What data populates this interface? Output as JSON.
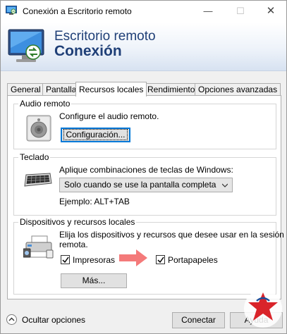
{
  "window": {
    "title": "Conexión a Escritorio remoto",
    "controls": {
      "minimize": "—",
      "maximize": "☐",
      "close": "✕"
    }
  },
  "banner": {
    "line1": "Escritorio remoto",
    "line2": "Conexión"
  },
  "tabs": [
    {
      "label": "General",
      "active": false
    },
    {
      "label": "Pantalla",
      "active": false
    },
    {
      "label": "Recursos locales",
      "active": true
    },
    {
      "label": "Rendimiento",
      "active": false
    },
    {
      "label": "Opciones avanzadas",
      "active": false
    }
  ],
  "audio": {
    "legend": "Audio remoto",
    "description": "Configure el audio remoto.",
    "button": "Configuración..."
  },
  "keyboard": {
    "legend": "Teclado",
    "description": "Aplique combinaciones de teclas de Windows:",
    "selected": "Solo cuando se use la pantalla completa",
    "example": "Ejemplo: ALT+TAB"
  },
  "devices": {
    "legend": "Dispositivos y recursos locales",
    "description_line1": "Elija los dispositivos y recursos que desee usar en la sesión",
    "description_line2": "remota.",
    "printers": {
      "label": "Impresoras",
      "checked": true
    },
    "clipboard": {
      "label": "Portapapeles",
      "checked": true
    },
    "more_button": "Más..."
  },
  "footer": {
    "hide_options": "Ocultar opciones",
    "connect": "Conectar",
    "help": "Ayuda"
  },
  "colors": {
    "banner_text": "#1f3f77",
    "accent": "#0078d7",
    "arrow": "#f47a7a"
  }
}
